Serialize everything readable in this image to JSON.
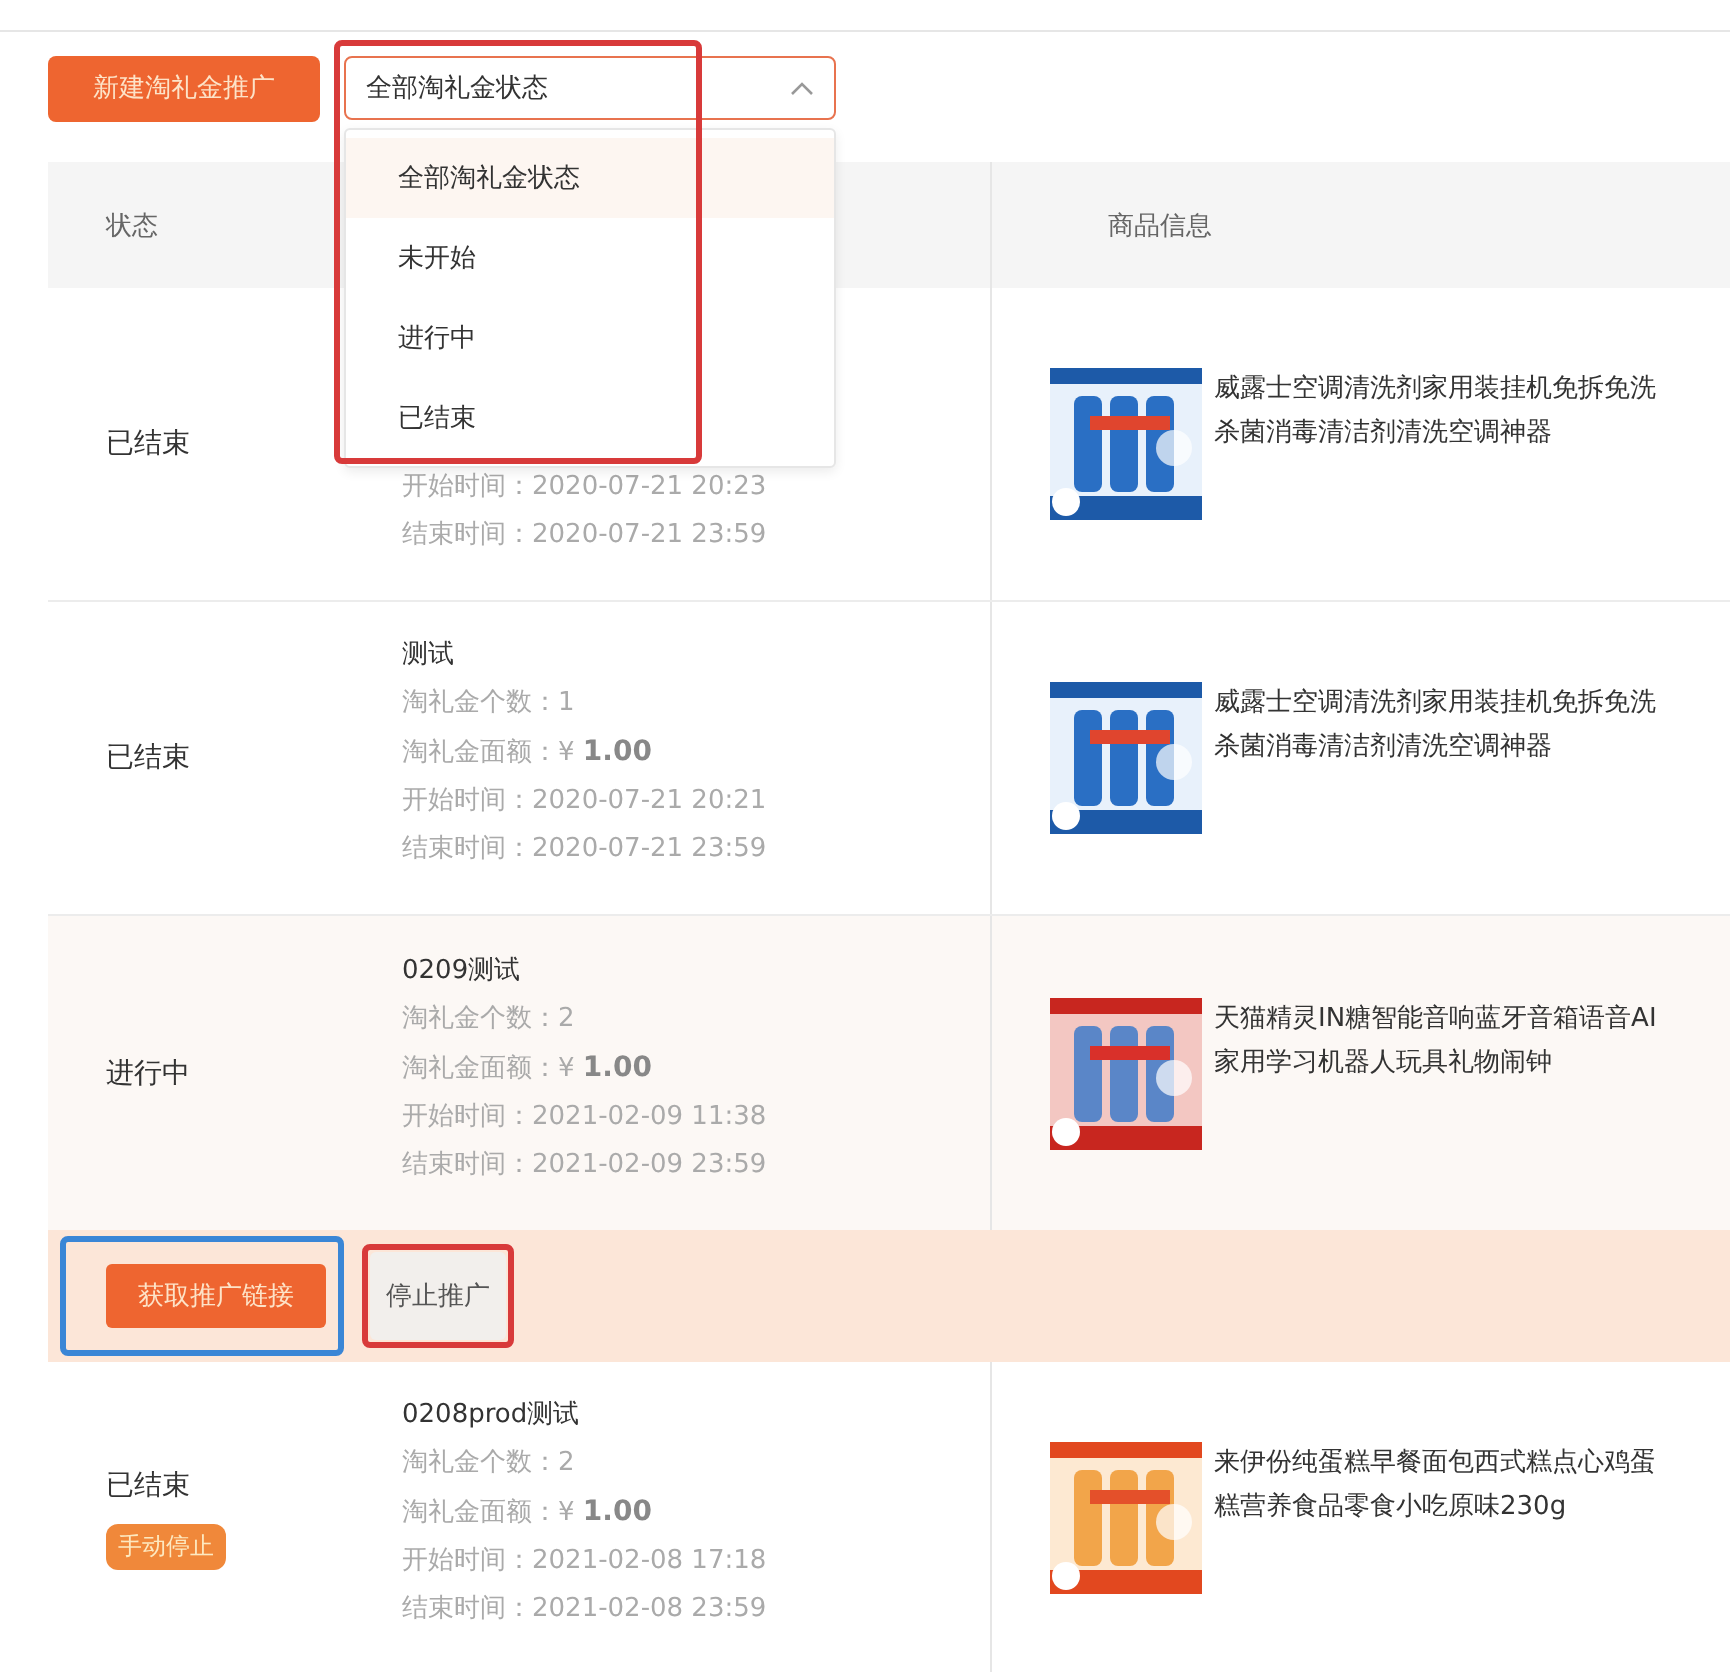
{
  "toolbar": {
    "create_button": "新建淘礼金推广",
    "status_filter": {
      "value": "全部淘礼金状态",
      "expanded": true,
      "annotation": {
        "color": "#d83a3a"
      },
      "options": [
        {
          "label": "全部淘礼金状态",
          "selected": true
        },
        {
          "label": "未开始",
          "selected": false
        },
        {
          "label": "进行中",
          "selected": false
        },
        {
          "label": "已结束",
          "selected": false
        }
      ]
    }
  },
  "table": {
    "columns": [
      {
        "label": "状态"
      },
      {
        "label": "商品信息"
      }
    ],
    "rows": [
      {
        "status": "已结束",
        "start_time": "开始时间：2020-07-21 20:23",
        "end_time": "结束时间：2020-07-21 23:59",
        "product": {
          "kind": "picture",
          "title": "威露士空调清洗剂家用装挂机免拆免洗杀菌消毒清洁剂清洗空调神器"
        },
        "highlighted": false
      },
      {
        "status": "已结束",
        "name": "测试",
        "count": "淘礼金个数：1",
        "amount": "淘礼金面额：¥ **1.00**",
        "start_time": "开始时间：2020-07-21 20:21",
        "end_time": "结束时间：2020-07-21 23:59",
        "product": {
          "kind": "picture",
          "title": "威露士空调清洗剂家用装挂机免拆免洗杀菌消毒清洁剂清洗空调神器"
        },
        "highlighted": false
      },
      {
        "status": "进行中",
        "name": "0209测试",
        "count": "淘礼金个数：2",
        "amount": "淘礼金面额：¥ **1.00**",
        "start_time": "开始时间：2021-02-09 11:38",
        "end_time": "结束时间：2021-02-09 23:59",
        "product": {
          "kind": "picture",
          "title": "天猫精灵IN糖智能音响蓝牙音箱语音AI家用学习机器人玩具礼物闹钟"
        },
        "highlighted": true,
        "actions": [
          {
            "label": "获取推广链接",
            "kind": "primary",
            "annotation": {
              "color": "#3a86d6"
            }
          },
          {
            "label": "停止推广",
            "kind": "plain",
            "annotation": {
              "color": "#d83a3a"
            }
          }
        ]
      },
      {
        "status": "已结束",
        "badge": "手动停止",
        "name": "0208prod测试",
        "count": "淘礼金个数：2",
        "amount": "淘礼金面额：¥ **1.00**",
        "start_time": "开始时间：2021-02-08 17:18",
        "end_time": "结束时间：2021-02-08 23:59",
        "product": {
          "kind": "picture",
          "title": "来伊份纯蛋糕早餐面包西式糕点心鸡蛋糕营养食品零食小吃原味230g"
        },
        "highlighted": false
      }
    ]
  }
}
